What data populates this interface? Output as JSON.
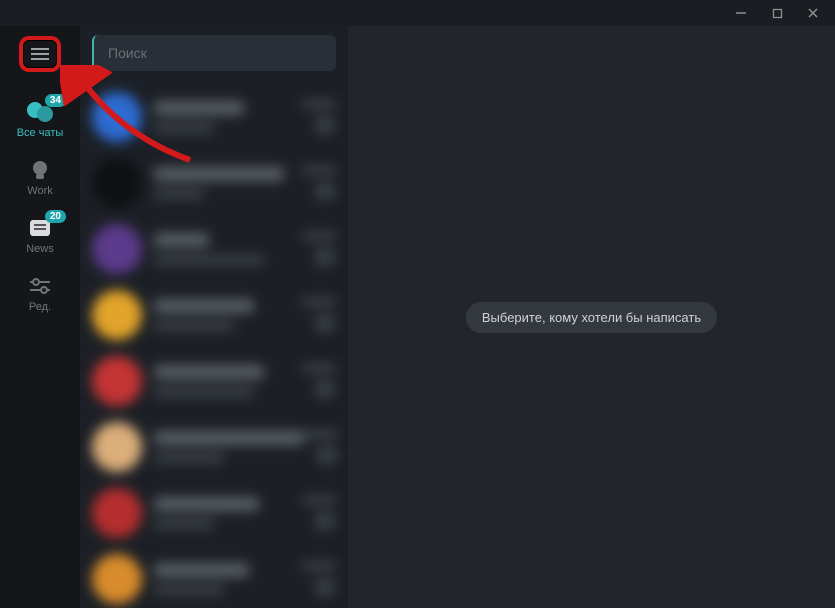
{
  "window": {
    "minimize": "—",
    "maximize": "☐",
    "close": "✕"
  },
  "sidebar": {
    "folders": [
      {
        "label": "Все чаты",
        "badge": "34"
      },
      {
        "label": "Work",
        "badge": ""
      },
      {
        "label": "News",
        "badge": "20"
      },
      {
        "label": "Ред.",
        "badge": ""
      }
    ]
  },
  "search": {
    "placeholder": "Поиск"
  },
  "chats": [
    {
      "avatarColor": "#2d6bd1",
      "titleW": 90,
      "subW": 60
    },
    {
      "avatarColor": "#0f1012",
      "titleW": 130,
      "subW": 50
    },
    {
      "avatarColor": "#5c3a8c",
      "titleW": 55,
      "subW": 110
    },
    {
      "avatarColor": "#e2a42a",
      "titleW": 100,
      "subW": 80
    },
    {
      "avatarColor": "#c43434",
      "titleW": 110,
      "subW": 100
    },
    {
      "avatarColor": "#dcae7a",
      "titleW": 150,
      "subW": 70
    },
    {
      "avatarColor": "#b52e2e",
      "titleW": 105,
      "subW": 60
    },
    {
      "avatarColor": "#d88b2c",
      "titleW": 95,
      "subW": 70
    }
  ],
  "main": {
    "placeholder": "Выберите, кому хотели бы написать"
  }
}
